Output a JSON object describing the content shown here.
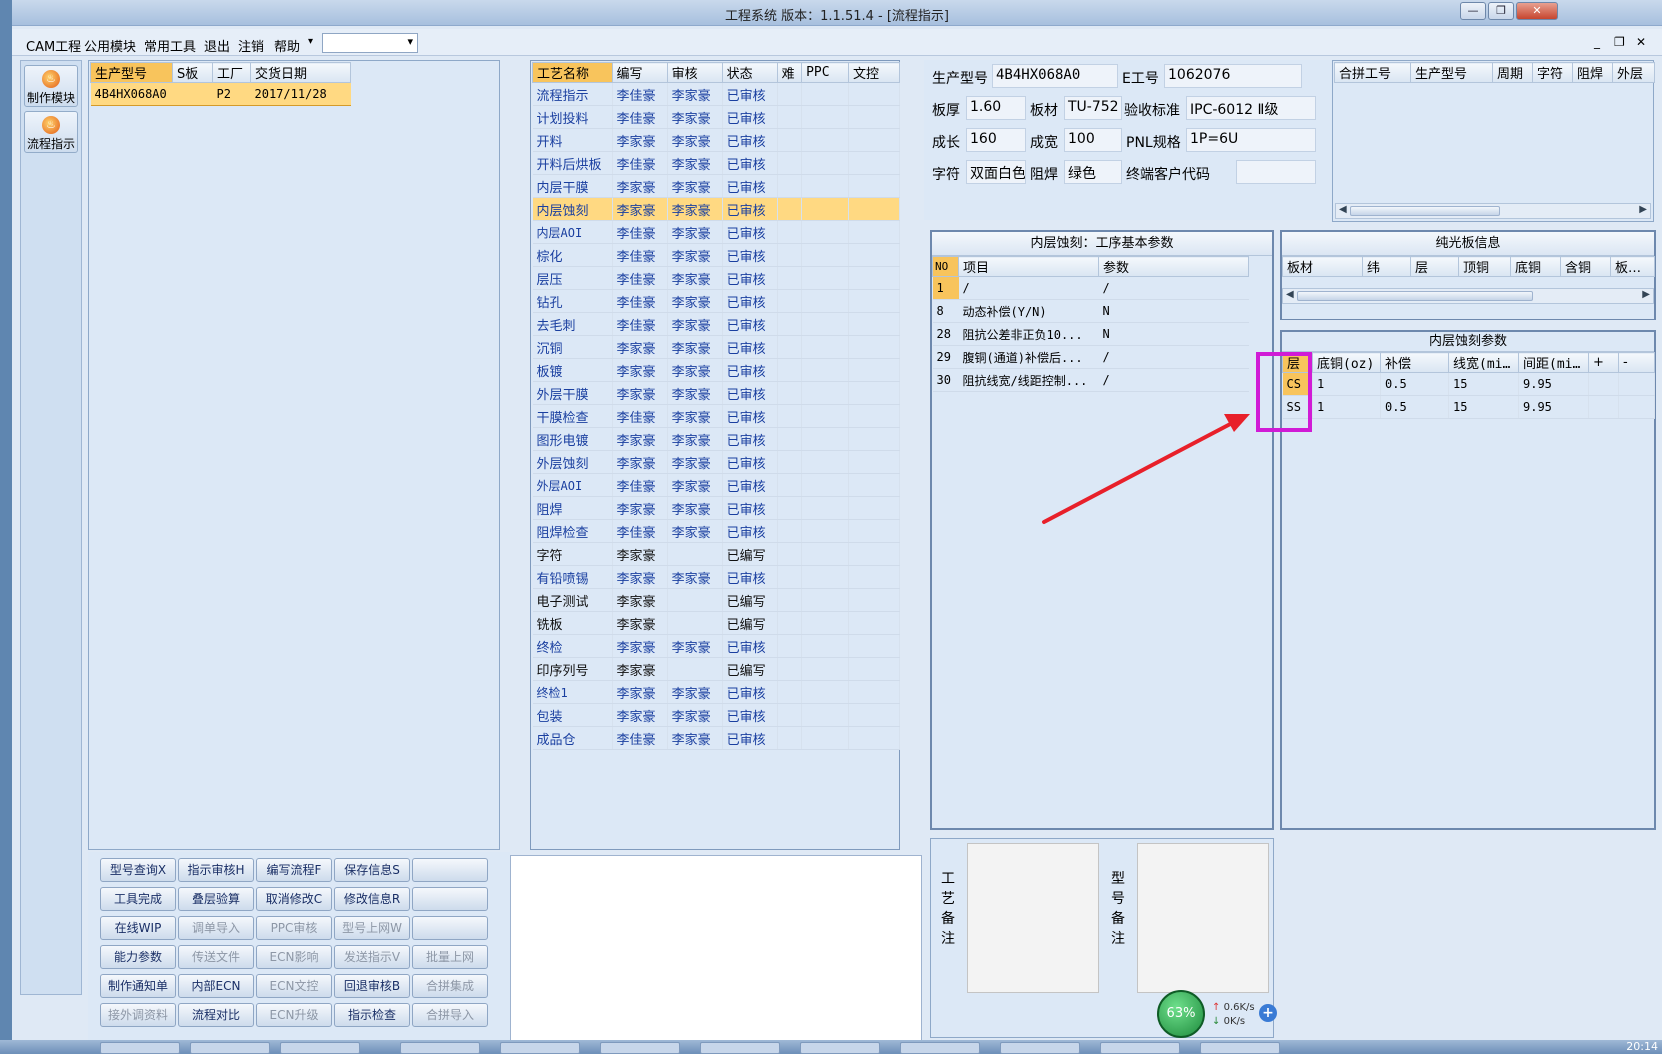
{
  "window": {
    "title": "工程系统  版本：1.1.51.4 - [流程指示]",
    "controls": {
      "minimize": "—",
      "restore": "❐",
      "close": "✕"
    }
  },
  "menu": {
    "items": [
      "CAM工程",
      "公用模块",
      "常用工具",
      "退出",
      "注销",
      "帮助"
    ],
    "combo_value": "",
    "mdi": {
      "min": "_",
      "restore": "❐",
      "close": "✕"
    }
  },
  "toolbar": {
    "make_module": "制作模块",
    "flow_indicate": "流程指示"
  },
  "orders": {
    "headers": [
      "生产型号",
      "S板",
      "工厂",
      "交货日期"
    ],
    "rows": [
      [
        "4B4HX068A0",
        "",
        "P2",
        "2017/11/28"
      ]
    ]
  },
  "process": {
    "headers": [
      "工艺名称",
      "编写",
      "审核",
      "状态",
      "难",
      "PPC",
      "文控"
    ],
    "rows": [
      [
        "流程指示",
        "李佳豪",
        "李家豪",
        "已审核"
      ],
      [
        "计划投料",
        "李佳豪",
        "李家豪",
        "已审核"
      ],
      [
        "开料",
        "李家豪",
        "李家豪",
        "已审核"
      ],
      [
        "开料后烘板",
        "李佳豪",
        "李家豪",
        "已审核"
      ],
      [
        "内层干膜",
        "李家豪",
        "李家豪",
        "已审核"
      ],
      [
        "内层蚀刻",
        "李家豪",
        "李家豪",
        "已审核"
      ],
      [
        "内层AOI",
        "李佳豪",
        "李家豪",
        "已审核"
      ],
      [
        "棕化",
        "李佳豪",
        "李家豪",
        "已审核"
      ],
      [
        "层压",
        "李佳豪",
        "李家豪",
        "已审核"
      ],
      [
        "钻孔",
        "李佳豪",
        "李家豪",
        "已审核"
      ],
      [
        "去毛刺",
        "李佳豪",
        "李家豪",
        "已审核"
      ],
      [
        "沉铜",
        "李家豪",
        "李家豪",
        "已审核"
      ],
      [
        "板镀",
        "李家豪",
        "李家豪",
        "已审核"
      ],
      [
        "外层干膜",
        "李家豪",
        "李家豪",
        "已审核"
      ],
      [
        "干膜检查",
        "李佳豪",
        "李家豪",
        "已审核"
      ],
      [
        "图形电镀",
        "李家豪",
        "李家豪",
        "已审核"
      ],
      [
        "外层蚀刻",
        "李家豪",
        "李家豪",
        "已审核"
      ],
      [
        "外层AOI",
        "李佳豪",
        "李家豪",
        "已审核"
      ],
      [
        "阻焊",
        "李家豪",
        "李家豪",
        "已审核"
      ],
      [
        "阻焊检查",
        "李佳豪",
        "李家豪",
        "已审核"
      ],
      [
        "字符",
        "李家豪",
        "",
        "已编写"
      ],
      [
        "有铅喷锡",
        "李家豪",
        "李家豪",
        "已审核"
      ],
      [
        "电子测试",
        "李家豪",
        "",
        "已编写"
      ],
      [
        "铣板",
        "李家豪",
        "",
        "已编写"
      ],
      [
        "终检",
        "李家豪",
        "李家豪",
        "已审核"
      ],
      [
        "印序列号",
        "李家豪",
        "",
        "已编写"
      ],
      [
        "终检1",
        "李家豪",
        "李家豪",
        "已审核"
      ],
      [
        "包装",
        "李家豪",
        "李家豪",
        "已审核"
      ],
      [
        "成品仓",
        "李佳豪",
        "李家豪",
        "已审核"
      ]
    ]
  },
  "info": {
    "model_label": "生产型号",
    "model": "4B4HX068A0",
    "eno_label": "E工号",
    "eno": "1062076",
    "thick_label": "板厚",
    "thick": "1.60",
    "material_label": "板材",
    "material": "TU-752",
    "std_label": "验收标准",
    "std": "IPC-6012 Ⅱ级",
    "len_label": "成长",
    "len": "160",
    "wid_label": "成宽",
    "wid": "100",
    "pnl_label": "PNL规格",
    "pnl": "1P=6U",
    "char_label": "字符",
    "char": "双面白色",
    "mask_label": "阻焊",
    "mask": "绿色",
    "cust_label": "终端客户代码",
    "cust": ""
  },
  "merge": {
    "headers": [
      "合拼工号",
      "生产型号",
      "周期",
      "字符",
      "阻焊",
      "外层"
    ]
  },
  "params": {
    "title": "内层蚀刻：工序基本参数",
    "headers": [
      "NO",
      "项目",
      "参数"
    ],
    "rows": [
      [
        "1",
        "/",
        "/"
      ],
      [
        "8",
        "动态补偿(Y/N)",
        "N"
      ],
      [
        "28",
        "阻抗公差非正负10...",
        "N"
      ],
      [
        "29",
        "腹铜(通道)补偿后...",
        "/"
      ],
      [
        "30",
        "阻抗线宽/线距控制...",
        "/"
      ]
    ]
  },
  "board": {
    "title": "纯光板信息",
    "headers": [
      "板材",
      "纬",
      "层",
      "顶铜",
      "底铜",
      "含铜",
      "板mm"
    ]
  },
  "etch": {
    "title": "内层蚀刻参数",
    "headers": [
      "层",
      "底铜(oz)",
      "补偿",
      "线宽(mil)",
      "间距(mil)",
      "+",
      "-"
    ],
    "rows": [
      [
        "CS",
        "1",
        "0.5",
        "15",
        "9.95",
        "",
        ""
      ],
      [
        "SS",
        "1",
        "0.5",
        "15",
        "9.95",
        "",
        ""
      ]
    ]
  },
  "remarks": {
    "craft_label": "工艺备注",
    "model_label": "型号备注"
  },
  "buttons": [
    [
      "型号查询X",
      "指示审核H",
      "编写流程F",
      "保存信息S",
      ""
    ],
    [
      "工具完成",
      "叠层验算",
      "取消修改C",
      "修改信息R",
      ""
    ],
    [
      "在线WIP",
      "调单导入",
      "PPC审核",
      "型号上网W",
      ""
    ],
    [
      "能力参数",
      "传送文件",
      "ECN影响",
      "发送指示V",
      "批量上网"
    ],
    [
      "制作通知单",
      "内部ECN",
      "ECN文控",
      "回退审核B",
      "合拼集成"
    ],
    [
      "接外调资料",
      "流程对比",
      "ECN升级",
      "指示检查",
      "合拼导入"
    ]
  ],
  "disabled_buttons": [
    "调单导入",
    "PPC审核",
    "型号上网W",
    "传送文件",
    "ECN影响",
    "发送指示V",
    "批量上网",
    "ECN文控",
    "合拼集成",
    "接外调资料",
    "ECN升级",
    "合拼导入"
  ],
  "network": {
    "percent": "63%",
    "up": "0.6K/s",
    "down": "0K/s"
  },
  "clock": "20:14",
  "colors": {
    "selection": "#ffd982",
    "header_selected": "#f8c45c",
    "highlight_box": "#d01bd6",
    "arrow": "#e8202a",
    "link_text": "#1a3fa0"
  }
}
